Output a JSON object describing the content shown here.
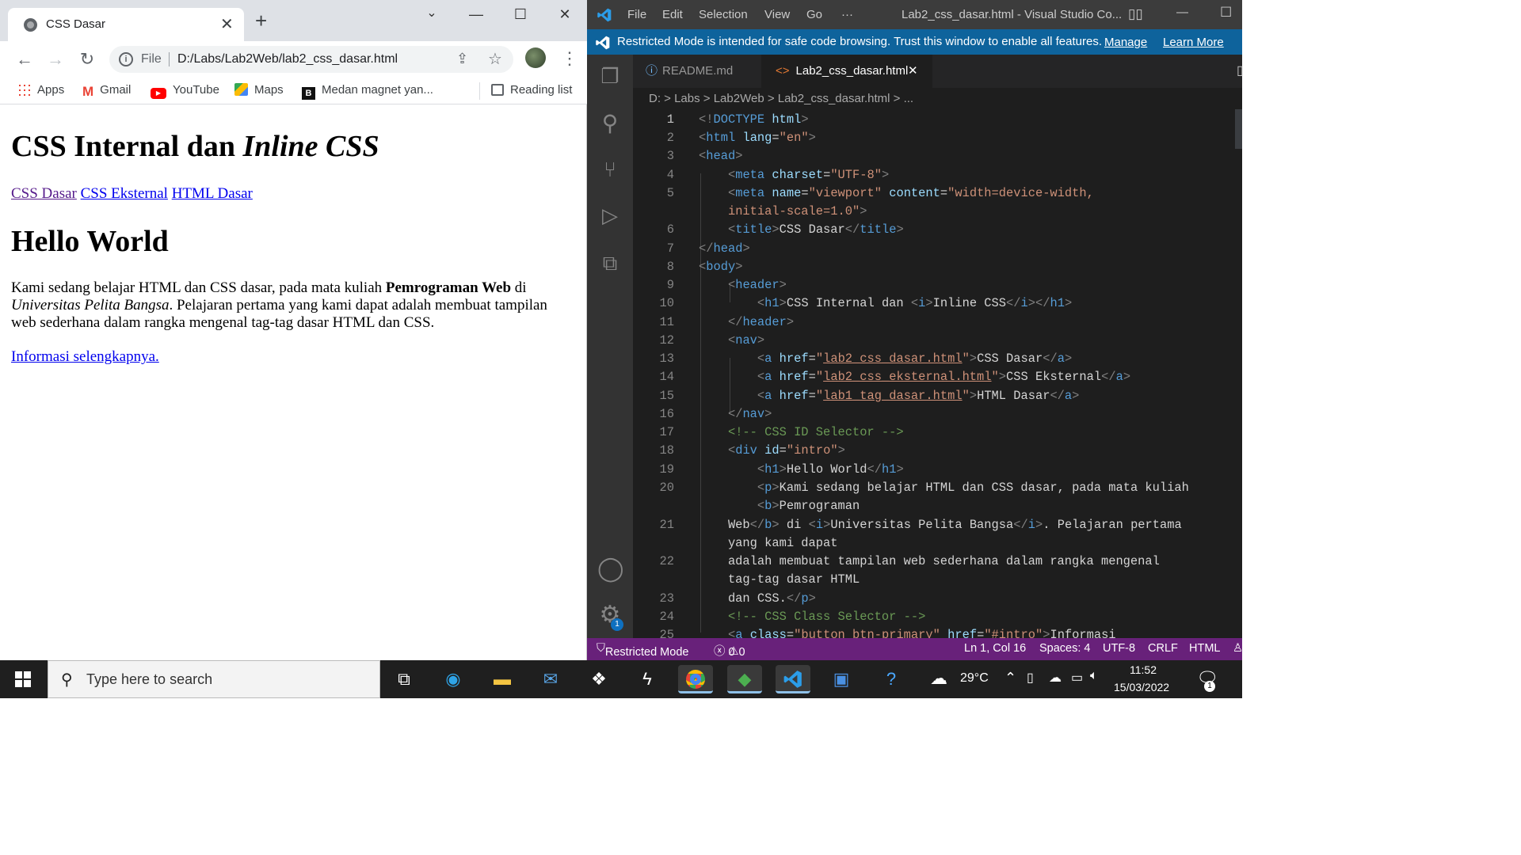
{
  "chrome": {
    "tab_title": "CSS Dasar",
    "omnibox": {
      "scheme": "File",
      "url": "D:/Labs/Lab2Web/lab2_css_dasar.html"
    },
    "bookmarks": [
      "Apps",
      "Gmail",
      "YouTube",
      "Maps",
      "Medan magnet yan..."
    ],
    "reading_list": "Reading list"
  },
  "page": {
    "h1_main": "CSS Internal dan ",
    "h1_italic": "Inline CSS",
    "nav": [
      "CSS Dasar",
      "CSS Eksternal",
      "HTML Dasar"
    ],
    "h1_hello": "Hello World",
    "para": {
      "part1": "Kami sedang belajar HTML dan CSS dasar, pada mata kuliah ",
      "bold": "Pemrograman Web",
      "part2": " di ",
      "italic": "Universitas Pelita Bangsa",
      "part3": ". Pelajaran pertama yang kami dapat adalah membuat tampilan web sederhana dalam rangka mengenal tag-tag dasar HTML dan CSS."
    },
    "more_link": "Informasi selengkapnya."
  },
  "vscode": {
    "menu": [
      "File",
      "Edit",
      "Selection",
      "View",
      "Go",
      "···"
    ],
    "window_title": "Lab2_css_dasar.html - Visual Studio Co...",
    "banner": {
      "text": "Restricted Mode is intended for safe code browsing. Trust this window to enable all features.",
      "manage": "Manage",
      "learn_more": "Learn More"
    },
    "tabs": [
      "README.md",
      "Lab2_css_dasar.html"
    ],
    "breadcrumbs": "D:  >  Labs  >  Lab2Web  >    Lab2_css_dasar.html  >  ...",
    "line_numbers": [
      "1",
      "2",
      "3",
      "4",
      "5",
      "",
      "6",
      "7",
      "8",
      "9",
      "10",
      "11",
      "12",
      "13",
      "14",
      "15",
      "16",
      "17",
      "18",
      "19",
      "20",
      "",
      "21",
      "",
      "22",
      "",
      "23",
      "24",
      "25"
    ],
    "settings_badge": "1",
    "status": {
      "mode": "Restricted Mode",
      "errors": "0",
      "warnings": "0",
      "position": "Ln 1, Col 16",
      "spaces": "Spaces: 4",
      "encoding": "UTF-8",
      "eol": "CRLF",
      "language": "HTML"
    }
  },
  "taskbar": {
    "search_placeholder": "Type here to search",
    "temperature": "29°C",
    "time": "11:52",
    "date": "15/03/2022",
    "notification_count": "1"
  }
}
